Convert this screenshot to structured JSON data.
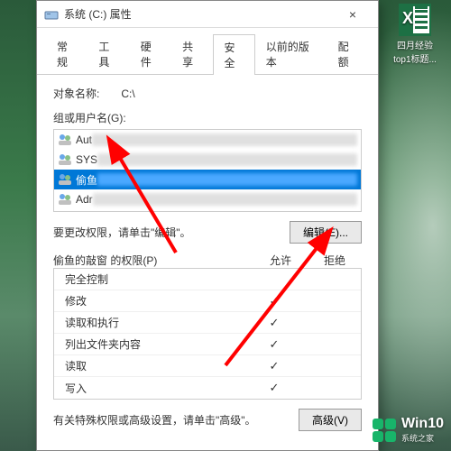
{
  "window": {
    "title": "系统 (C:) 属性",
    "close_symbol": "×"
  },
  "tabs": [
    "常规",
    "工具",
    "硬件",
    "共享",
    "安全",
    "以前的版本",
    "配额"
  ],
  "active_tab_index": 4,
  "object_name": {
    "label": "对象名称:",
    "value": "C:\\"
  },
  "groups_label": "组或用户名(G):",
  "users": [
    {
      "prefix": "Aut",
      "selected": false
    },
    {
      "prefix": "SYS",
      "selected": false
    },
    {
      "prefix": "偷鱼",
      "selected": true
    },
    {
      "prefix": "Adr",
      "selected": false
    }
  ],
  "edit_hint": "要更改权限，请单击\"编辑\"。",
  "edit_button": "编辑(E)...",
  "perm_title": "偷鱼的敲窗 的权限(P)",
  "perm_cols": {
    "allow": "允许",
    "deny": "拒绝"
  },
  "permissions": [
    {
      "name": "完全控制",
      "allow": false,
      "deny": false
    },
    {
      "name": "修改",
      "allow": true,
      "deny": false
    },
    {
      "name": "读取和执行",
      "allow": true,
      "deny": false
    },
    {
      "name": "列出文件夹内容",
      "allow": true,
      "deny": false
    },
    {
      "name": "读取",
      "allow": true,
      "deny": false
    },
    {
      "name": "写入",
      "allow": true,
      "deny": false
    }
  ],
  "advanced_hint": "有关特殊权限或高级设置，请单击\"高级\"。",
  "advanced_button": "高级(V)",
  "desktop_file": {
    "line1": "四月经验",
    "line2": "top1标题...",
    "ext": ""
  },
  "watermark": {
    "brand": "Win10",
    "site": "系统之家"
  }
}
